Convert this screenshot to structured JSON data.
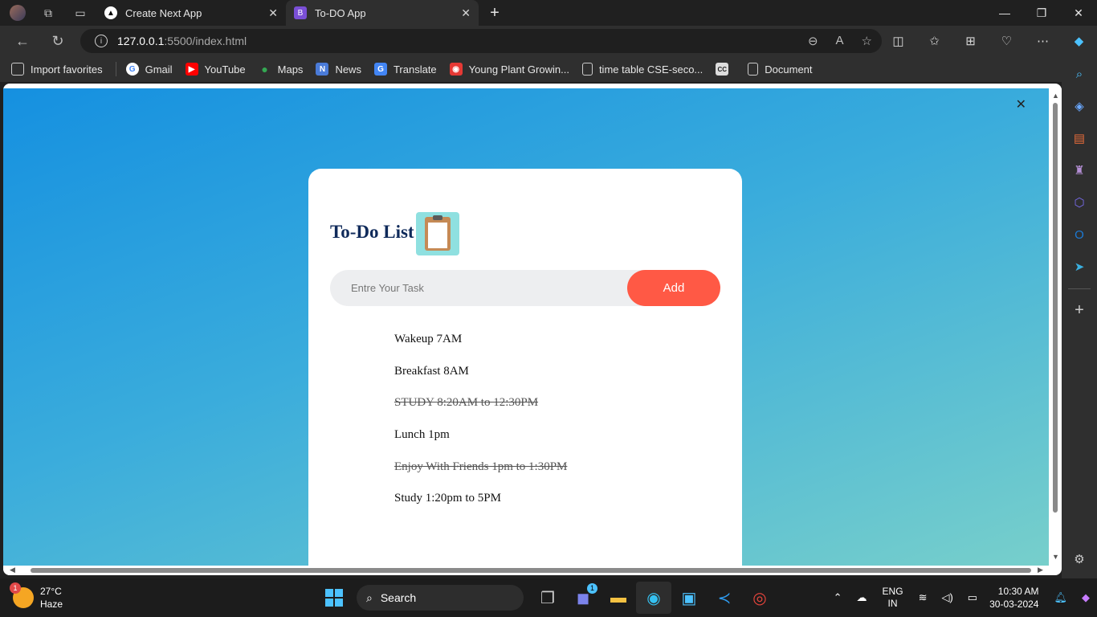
{
  "browser": {
    "tabs": [
      {
        "title": "Create Next App",
        "active": false
      },
      {
        "title": "To-DO App",
        "active": true
      }
    ],
    "address": {
      "host": "127.0.0.1",
      "path": ":5500/index.html"
    },
    "favorites": [
      {
        "label": "Import favorites",
        "icon": "import-icon"
      },
      {
        "label": "Gmail",
        "icon": "google-icon"
      },
      {
        "label": "YouTube",
        "icon": "youtube-icon"
      },
      {
        "label": "Maps",
        "icon": "maps-pin-icon"
      },
      {
        "label": "News",
        "icon": "news-icon"
      },
      {
        "label": "Translate",
        "icon": "translate-icon"
      },
      {
        "label": "Young Plant Growin...",
        "icon": "app-icon"
      },
      {
        "label": "time table CSE-seco...",
        "icon": "document-icon"
      },
      {
        "label": "Document",
        "icon": "document-icon"
      }
    ]
  },
  "app": {
    "title": "To-Do List",
    "input_placeholder": "Entre Your Task",
    "add_label": "Add",
    "tasks": [
      {
        "text": "Wakeup 7AM",
        "done": false
      },
      {
        "text": "Breakfast 8AM",
        "done": false
      },
      {
        "text": "STUDY 8:20AM to 12:30PM",
        "done": true
      },
      {
        "text": "Lunch 1pm",
        "done": false
      },
      {
        "text": "Enjoy With Friends 1pm to 1:30PM",
        "done": true
      },
      {
        "text": "Study 1:20pm to 5PM",
        "done": false
      }
    ]
  },
  "taskbar": {
    "weather_temp": "27°C",
    "weather_desc": "Haze",
    "weather_badge": "1",
    "search_label": "Search",
    "lang_top": "ENG",
    "lang_bottom": "IN",
    "time": "10:30 AM",
    "date": "30-03-2024",
    "teams_badge": "1"
  },
  "colors": {
    "accent_button": "#ff5945",
    "title_color": "#0f2a5a",
    "gradient_start": "#1590e0",
    "gradient_end": "#77cfcb"
  }
}
